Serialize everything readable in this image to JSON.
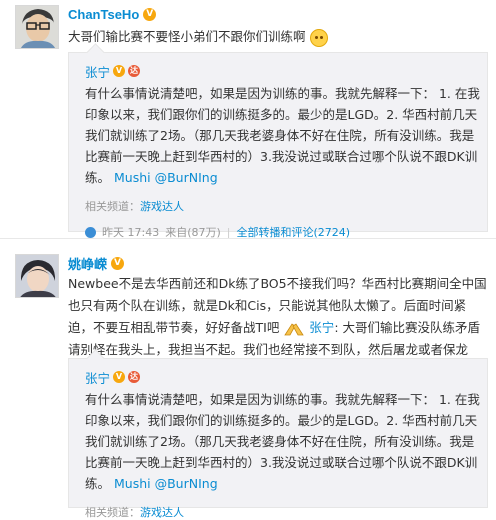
{
  "post1": {
    "author": "ChanTseHo",
    "vip_icon": "vip-badge",
    "text": "大哥们输比赛不要怪小弟们不跟你们训练啊",
    "emoji": "sad-face",
    "quote": {
      "author": "张宁",
      "text": "有什么事情说清楚吧，如果是因为训练的事。我就先解释一下： 1. 在我印象以来，我们跟你们的训练挺多的。最少的是LGD。2. 华西村前几天我们就训练了2场。（那几天我老婆身体不好在住院，所有没训练。我是比赛前一天晚上赶到华西村的）3.我没说过或联合过哪个队说不跟DK训练。",
      "mentions": [
        "Mushi",
        "@BurNIng"
      ],
      "channel_label": "相关频道：",
      "channel_name": "游戏达人",
      "time": "昨天 17:43",
      "source": "来自(87万)",
      "forward_link": "全部转播和评论(2724)"
    }
  },
  "post2": {
    "author": "姚峥嵘",
    "text": "Newbee不是去华西前还和Dk练了BO5不接我们吗？华西村比赛期间全中国也只有两个队在训练，就是Dk和Cis，只能说其他队太懒了。后面时间紧迫，不要互相乱带节奏，好好备战TI吧",
    "reply_mention": "张宁",
    "reply_text": ": 大哥们输比赛没队练矛盾请别怪在我头上，我担当不起。我们也经常接不到队，然后屠龙或者保龙",
    "quote": {
      "author": "张宁",
      "text": "有什么事情说清楚吧，如果是因为训练的事。我就先解释一下： 1. 在我印象以来，我们跟你们的训练挺多的。最少的是LGD。2. 华西村前几天我们就训练了2场。（那几天我老婆身体不好在住院，所有没训练。我是比赛前一天晚上赶到华西村的）3.我没说过或联合过哪个队说不跟DK训练。",
      "mentions": [
        "Mushi",
        "@BurNIng"
      ],
      "channel_label": "相关频道：",
      "channel_name": "游戏达人"
    }
  },
  "colors": {
    "link": "#0a8cd2",
    "quote_bg": "#f2f2f5",
    "vip": "#f7a70e"
  }
}
